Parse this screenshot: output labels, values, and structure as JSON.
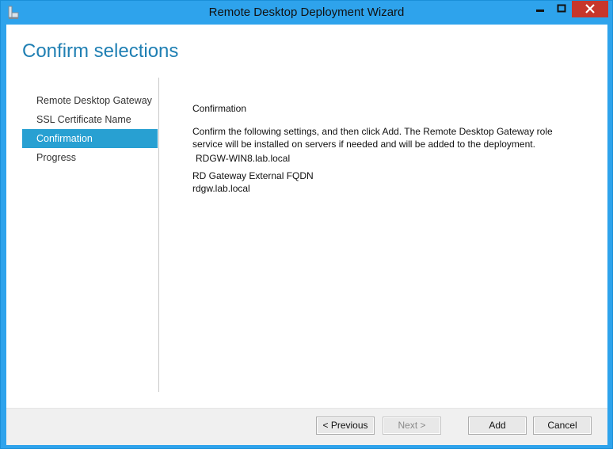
{
  "window": {
    "title": "Remote Desktop Deployment Wizard",
    "controls": {
      "minimize": "—",
      "maximize": "□",
      "close": "✕"
    },
    "accent": "#2ea3ec",
    "close_color": "#c7362b"
  },
  "header": {
    "title": "Confirm selections"
  },
  "nav": {
    "items": [
      {
        "label": "Remote Desktop Gateway",
        "active": false
      },
      {
        "label": "SSL Certificate Name",
        "active": false
      },
      {
        "label": "Confirmation",
        "active": true
      },
      {
        "label": "Progress",
        "active": false
      }
    ],
    "active_color": "#28a0d2"
  },
  "content": {
    "section_title": "Confirmation",
    "description": "Confirm the following settings, and then click Add. The Remote Desktop Gateway role service will be installed on servers if needed and will be added to the deployment.",
    "server": "RDGW-WIN8.lab.local",
    "fqdn_label": "RD Gateway External FQDN",
    "fqdn_value": "rdgw.lab.local"
  },
  "footer": {
    "previous_label": "< Previous",
    "next_label": "Next >",
    "add_label": "Add",
    "cancel_label": "Cancel"
  }
}
